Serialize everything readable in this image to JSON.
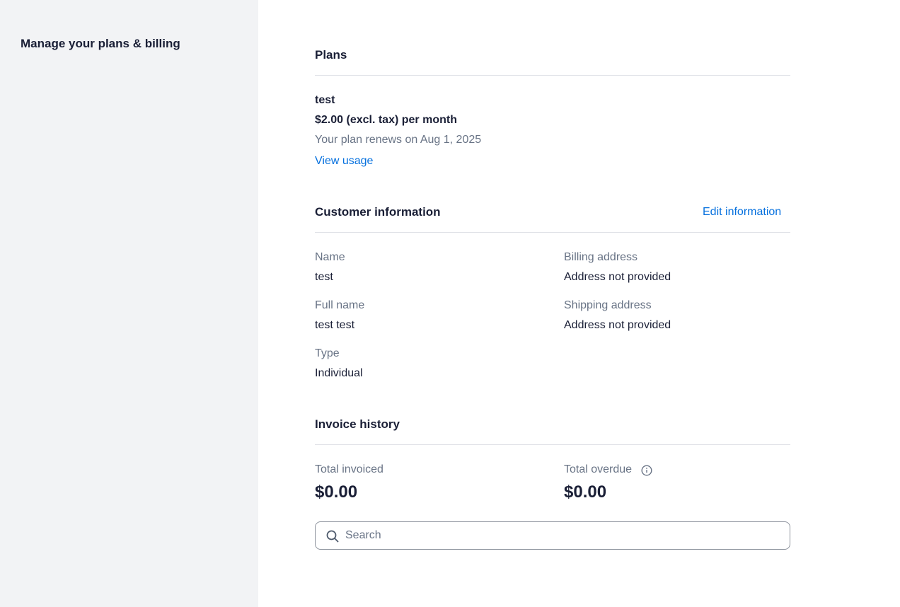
{
  "sidebar": {
    "title": "Manage your plans & billing"
  },
  "plans": {
    "heading": "Plans",
    "plan_name": "test",
    "price": "$2.00 (excl. tax) per month",
    "renewal": "Your plan renews on Aug 1, 2025",
    "view_usage_link": "View usage"
  },
  "customer": {
    "heading": "Customer information",
    "edit_link": "Edit information",
    "fields": {
      "name_label": "Name",
      "name_value": "test",
      "full_name_label": "Full name",
      "full_name_value": "test test",
      "type_label": "Type",
      "type_value": "Individual",
      "billing_label": "Billing address",
      "billing_value": "Address not provided",
      "shipping_label": "Shipping address",
      "shipping_value": "Address not provided"
    }
  },
  "invoices": {
    "heading": "Invoice history",
    "total_invoiced_label": "Total invoiced",
    "total_invoiced_value": "$0.00",
    "total_overdue_label": "Total overdue",
    "total_overdue_value": "$0.00",
    "search_placeholder": "Search",
    "search_value": ""
  },
  "icons": {
    "info": "info-icon",
    "search": "search-icon"
  },
  "colors": {
    "link": "#0570de",
    "muted_text": "#687385",
    "sidebar_bg": "#f2f3f5"
  }
}
